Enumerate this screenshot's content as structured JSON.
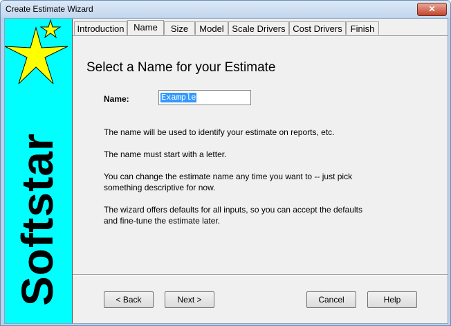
{
  "window": {
    "title": "Create Estimate Wizard",
    "close_glyph": "✕"
  },
  "sidebar": {
    "brand": "Softstar",
    "background": "#00ffff",
    "star_color": "#ffff00"
  },
  "tabs": [
    {
      "label": "Introduction"
    },
    {
      "label": "Name",
      "active": true
    },
    {
      "label": "Size"
    },
    {
      "label": "Model"
    },
    {
      "label": "Scale Drivers"
    },
    {
      "label": "Cost Drivers"
    },
    {
      "label": "Finish"
    }
  ],
  "page": {
    "heading": "Select a Name for your Estimate",
    "name_label": "Name:",
    "name_value": "Example",
    "paragraphs": [
      "The name will be used to identify your estimate on reports, etc.",
      "The name must start with a letter.",
      "You can change the estimate name any time you want to -- just pick\nsomething descriptive for now.",
      "The wizard offers defaults for all inputs, so you can accept the defaults\nand fine-tune the estimate later."
    ]
  },
  "buttons": {
    "back": "< Back",
    "next": "Next >",
    "cancel": "Cancel",
    "help": "Help"
  }
}
